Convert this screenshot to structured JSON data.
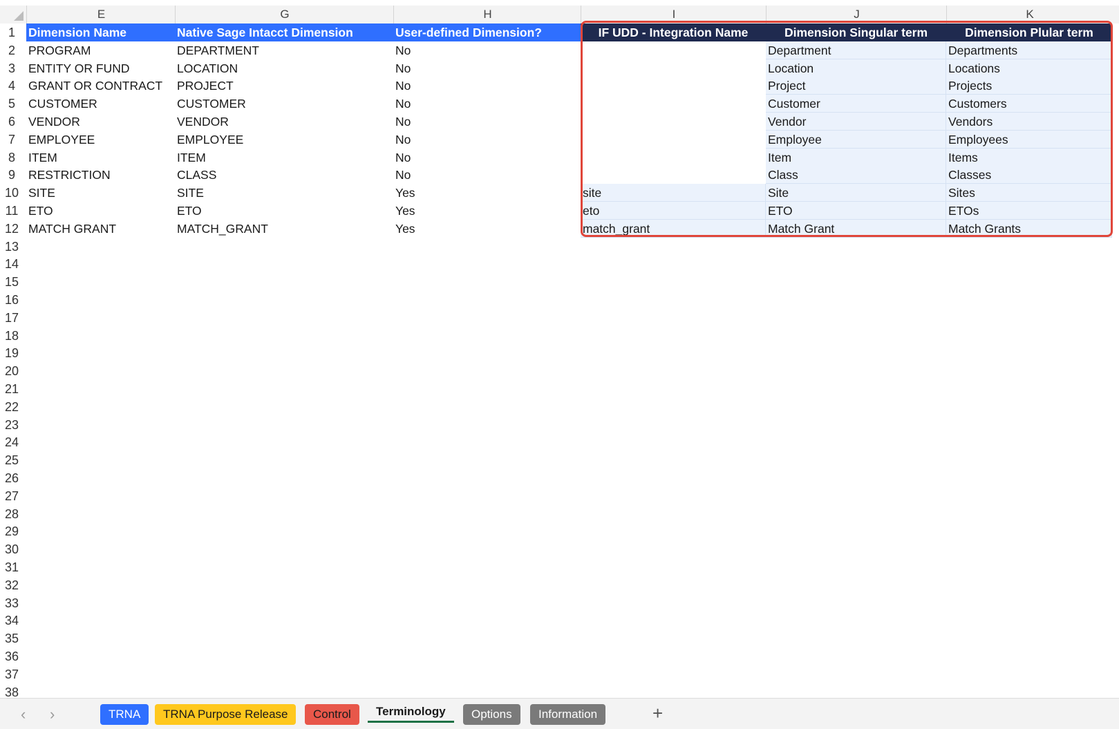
{
  "columns": [
    {
      "letter": "E"
    },
    {
      "letter": "G"
    },
    {
      "letter": "H"
    },
    {
      "letter": "I"
    },
    {
      "letter": "J"
    },
    {
      "letter": "K"
    }
  ],
  "header_row": {
    "dimension_name": "Dimension Name",
    "native_dimension": "Native Sage Intacct Dimension",
    "user_defined": "User-defined Dimension?",
    "integration_name": "IF UDD - Integration Name",
    "singular": "Dimension Singular term",
    "plural": "Dimension Plular term"
  },
  "rows": [
    {
      "e": "PROGRAM",
      "g": "DEPARTMENT",
      "h": "No",
      "i": "",
      "j": "Department",
      "k": "Departments"
    },
    {
      "e": "ENTITY OR FUND",
      "g": "LOCATION",
      "h": "No",
      "i": "",
      "j": "Location",
      "k": "Locations"
    },
    {
      "e": "GRANT OR CONTRACT",
      "g": "PROJECT",
      "h": "No",
      "i": "",
      "j": "Project",
      "k": "Projects"
    },
    {
      "e": "CUSTOMER",
      "g": "CUSTOMER",
      "h": "No",
      "i": "",
      "j": "Customer",
      "k": "Customers"
    },
    {
      "e": "VENDOR",
      "g": "VENDOR",
      "h": "No",
      "i": "",
      "j": "Vendor",
      "k": "Vendors"
    },
    {
      "e": "EMPLOYEE",
      "g": "EMPLOYEE",
      "h": "No",
      "i": "",
      "j": "Employee",
      "k": "Employees"
    },
    {
      "e": "ITEM",
      "g": "ITEM",
      "h": "No",
      "i": "",
      "j": "Item",
      "k": "Items"
    },
    {
      "e": "RESTRICTION",
      "g": "CLASS",
      "h": "No",
      "i": "",
      "j": "Class",
      "k": "Classes"
    },
    {
      "e": "SITE",
      "g": "SITE",
      "h": "Yes",
      "i": "site",
      "j": "Site",
      "k": "Sites"
    },
    {
      "e": "ETO",
      "g": "ETO",
      "h": "Yes",
      "i": "eto",
      "j": "ETO",
      "k": "ETOs"
    },
    {
      "e": "MATCH GRANT",
      "g": "MATCH_GRANT",
      "h": "Yes",
      "i": "match_grant",
      "j": "Match Grant",
      "k": "Match Grants"
    }
  ],
  "row_numbers": [
    "1",
    "2",
    "3",
    "4",
    "5",
    "6",
    "7",
    "8",
    "9",
    "10",
    "11",
    "12",
    "13",
    "14",
    "15",
    "16",
    "17",
    "18",
    "19",
    "20",
    "21",
    "22",
    "23",
    "24",
    "25",
    "26",
    "27",
    "28",
    "29",
    "30",
    "31",
    "32",
    "33",
    "34",
    "35",
    "36",
    "37",
    "38"
  ],
  "sheet_tabs": {
    "prev_icon": "‹",
    "next_icon": "›",
    "tabs": [
      {
        "label": "TRNA",
        "color": "#2f6fff",
        "text": "#ffffff"
      },
      {
        "label": "TRNA Purpose Release",
        "color": "#ffc81e",
        "text": "#1a1a1a"
      },
      {
        "label": "Control",
        "color": "#e8574a",
        "text": "#1a1a1a"
      },
      {
        "label": "Terminology",
        "color": "",
        "text": "#1a1a1a"
      },
      {
        "label": "Options",
        "color": "#7a7a7a",
        "text": "#ffffff"
      },
      {
        "label": "Information",
        "color": "#7a7a7a",
        "text": "#ffffff"
      }
    ],
    "add_icon": "+"
  },
  "colors": {
    "header_blue": "#2f6fff",
    "header_navy": "#1f2a4f",
    "highlight_border": "#e0463a",
    "light_cell": "#ebf2fc"
  }
}
